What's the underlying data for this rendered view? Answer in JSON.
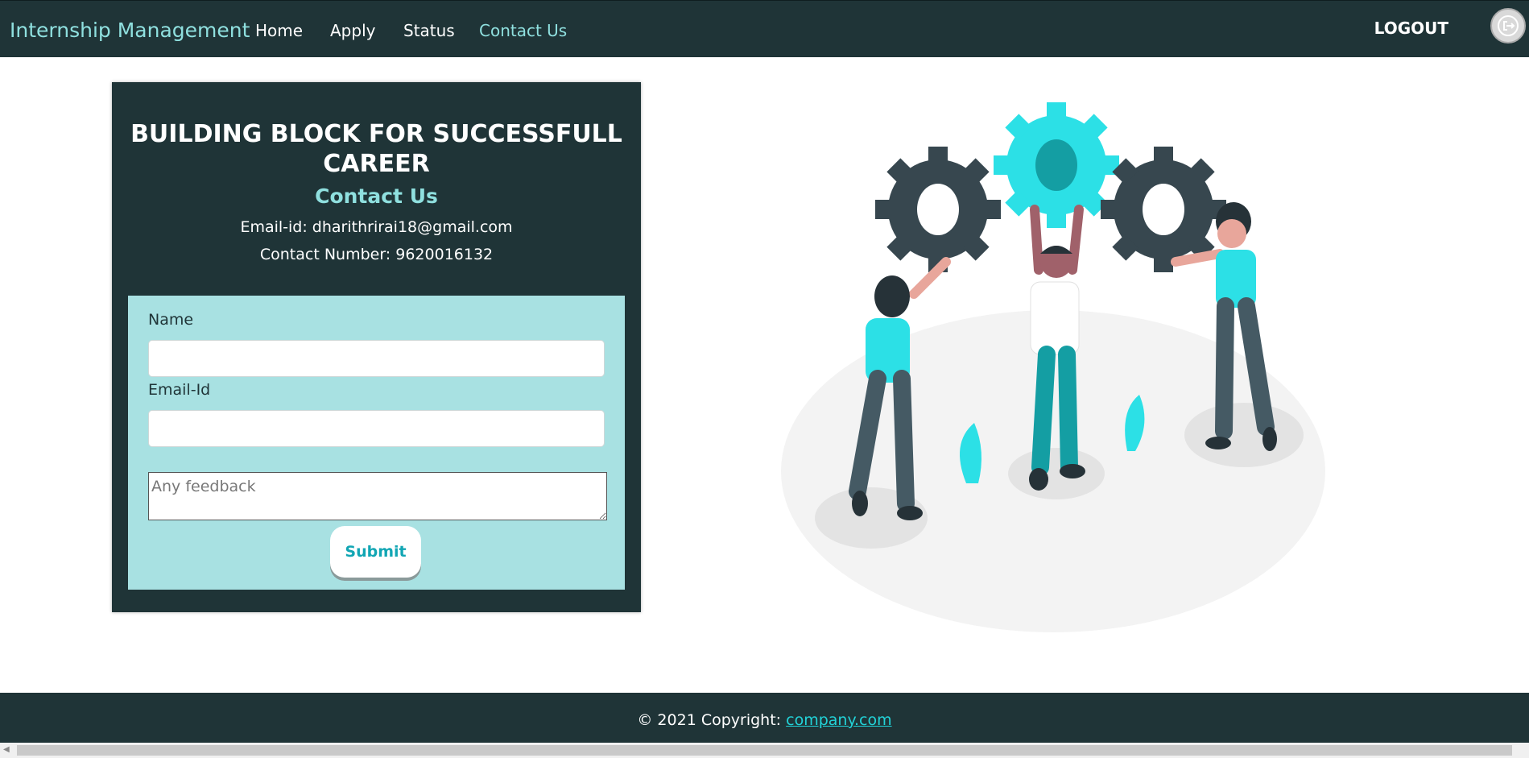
{
  "navbar": {
    "brand": "Internship Management",
    "items": [
      {
        "label": "Home",
        "active": false
      },
      {
        "label": "Apply",
        "active": false
      },
      {
        "label": "Status",
        "active": false
      },
      {
        "label": "Contact Us",
        "active": true
      }
    ],
    "logout_label": "LOGOUT",
    "logout_icon": "logout-icon"
  },
  "card": {
    "title": "BUILDING BLOCK FOR SUCCESSFULL CAREER",
    "subtitle": "Contact Us",
    "email_line": "Email-id: dharithrirai18@gmail.com",
    "phone_line": "Contact Number: 9620016132"
  },
  "form": {
    "name_label": "Name",
    "name_value": "",
    "email_label": "Email-Id",
    "email_value": "",
    "feedback_placeholder": "Any feedback",
    "submit_label": "Submit"
  },
  "footer": {
    "copyright": "© 2021 Copyright:",
    "link": "company.com"
  },
  "colors": {
    "dark": "#1f3437",
    "accent": "#8fe0df",
    "form_bg": "#a8e1e2",
    "teal": "#22d3d8"
  }
}
